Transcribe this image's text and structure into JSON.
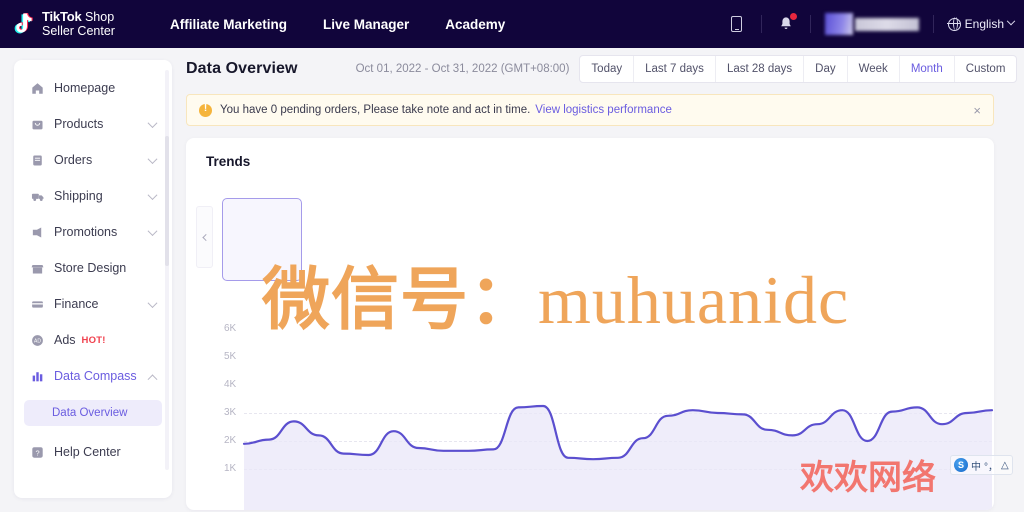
{
  "topbar": {
    "brand": {
      "bold": "TikTok",
      "light": " Shop",
      "line2": "Seller Center",
      "logo_icon": "tiktok-note-icon"
    },
    "nav": [
      {
        "label": "Affiliate Marketing"
      },
      {
        "label": "Live Manager"
      },
      {
        "label": "Academy"
      }
    ],
    "icons": {
      "device": "mobile-device-icon",
      "bell": "notification-bell-icon",
      "globe": "globe-icon",
      "chevron": "chevron-down-icon"
    },
    "language": "English"
  },
  "sidebar": {
    "items": [
      {
        "label": "Homepage",
        "icon": "home-icon",
        "expandable": false,
        "active": false
      },
      {
        "label": "Products",
        "icon": "box-icon",
        "expandable": true,
        "active": false
      },
      {
        "label": "Orders",
        "icon": "clipboard-icon",
        "expandable": true,
        "active": false
      },
      {
        "label": "Shipping",
        "icon": "truck-icon",
        "expandable": true,
        "active": false
      },
      {
        "label": "Promotions",
        "icon": "megaphone-icon",
        "expandable": true,
        "active": false
      },
      {
        "label": "Store Design",
        "icon": "storefront-icon",
        "expandable": false,
        "active": false
      },
      {
        "label": "Finance",
        "icon": "card-icon",
        "expandable": true,
        "active": false
      },
      {
        "label": "Ads",
        "icon": "ads-icon",
        "expandable": false,
        "active": false,
        "badge": "HOT!"
      },
      {
        "label": "Data Compass",
        "icon": "bar-chart-icon",
        "expandable": true,
        "active": true
      },
      {
        "label": "Help Center",
        "icon": "help-icon",
        "expandable": false,
        "active": false
      }
    ],
    "sub_item": {
      "label": "Data Overview",
      "parent": "Data Compass"
    }
  },
  "page": {
    "title": "Data Overview",
    "date_range": "Oct 01, 2022 - Oct 31, 2022 (GMT+08:00)",
    "range_buttons": [
      {
        "label": "Today",
        "active": false
      },
      {
        "label": "Last 7 days",
        "active": false
      },
      {
        "label": "Last 28 days",
        "active": false
      },
      {
        "label": "Day",
        "active": false
      },
      {
        "label": "Week",
        "active": false
      },
      {
        "label": "Month",
        "active": true
      },
      {
        "label": "Custom",
        "active": false
      }
    ]
  },
  "alert": {
    "icon": "warning-icon",
    "text": "You have 0 pending orders, Please take note and act in time.",
    "link": "View logistics performance",
    "close": "×"
  },
  "trends": {
    "title": "Trends",
    "prev_arrow": "chevron-left-icon"
  },
  "chart_data": {
    "type": "line",
    "title": "Trends",
    "xlabel": "",
    "ylabel": "",
    "ylim": [
      0,
      6500
    ],
    "grid": true,
    "legend": "none",
    "ytick_labels": [
      "6K",
      "5K",
      "4K",
      "3K",
      "2K",
      "1K"
    ],
    "ytick_values": [
      6000,
      5000,
      4000,
      3000,
      2000,
      1000
    ],
    "series": [
      {
        "name": "Trend",
        "color": "#5b4fcf",
        "fill_color": "#e9e7f8",
        "values": [
          1900,
          2050,
          2700,
          2200,
          1550,
          1500,
          2350,
          1750,
          1650,
          1650,
          1700,
          3200,
          3250,
          1400,
          1350,
          1400,
          2100,
          2900,
          3100,
          3000,
          2950,
          2400,
          2200,
          2600,
          3100,
          2000,
          3050,
          3200,
          2600,
          3000,
          3100
        ]
      }
    ]
  },
  "watermarks": {
    "orange_cn": "微信号：",
    "orange_latin": "muhuanidc",
    "red_cn": "欢欢网络"
  },
  "ime": {
    "logo": "sogou-ime-icon",
    "mode": "中",
    "punct": "°，",
    "shape": "△"
  },
  "colors": {
    "navy": "#11053b",
    "purple": "#6a5ce0",
    "chart_line": "#5b4fcf",
    "alert_bg": "#fffbef",
    "alert_border": "#f8e6bd",
    "warning": "#f5b43c",
    "hot": "#f03f4c",
    "watermark_orange": "#efa55a",
    "watermark_red": "#f2766f",
    "page_bg": "#f4f4f7"
  }
}
